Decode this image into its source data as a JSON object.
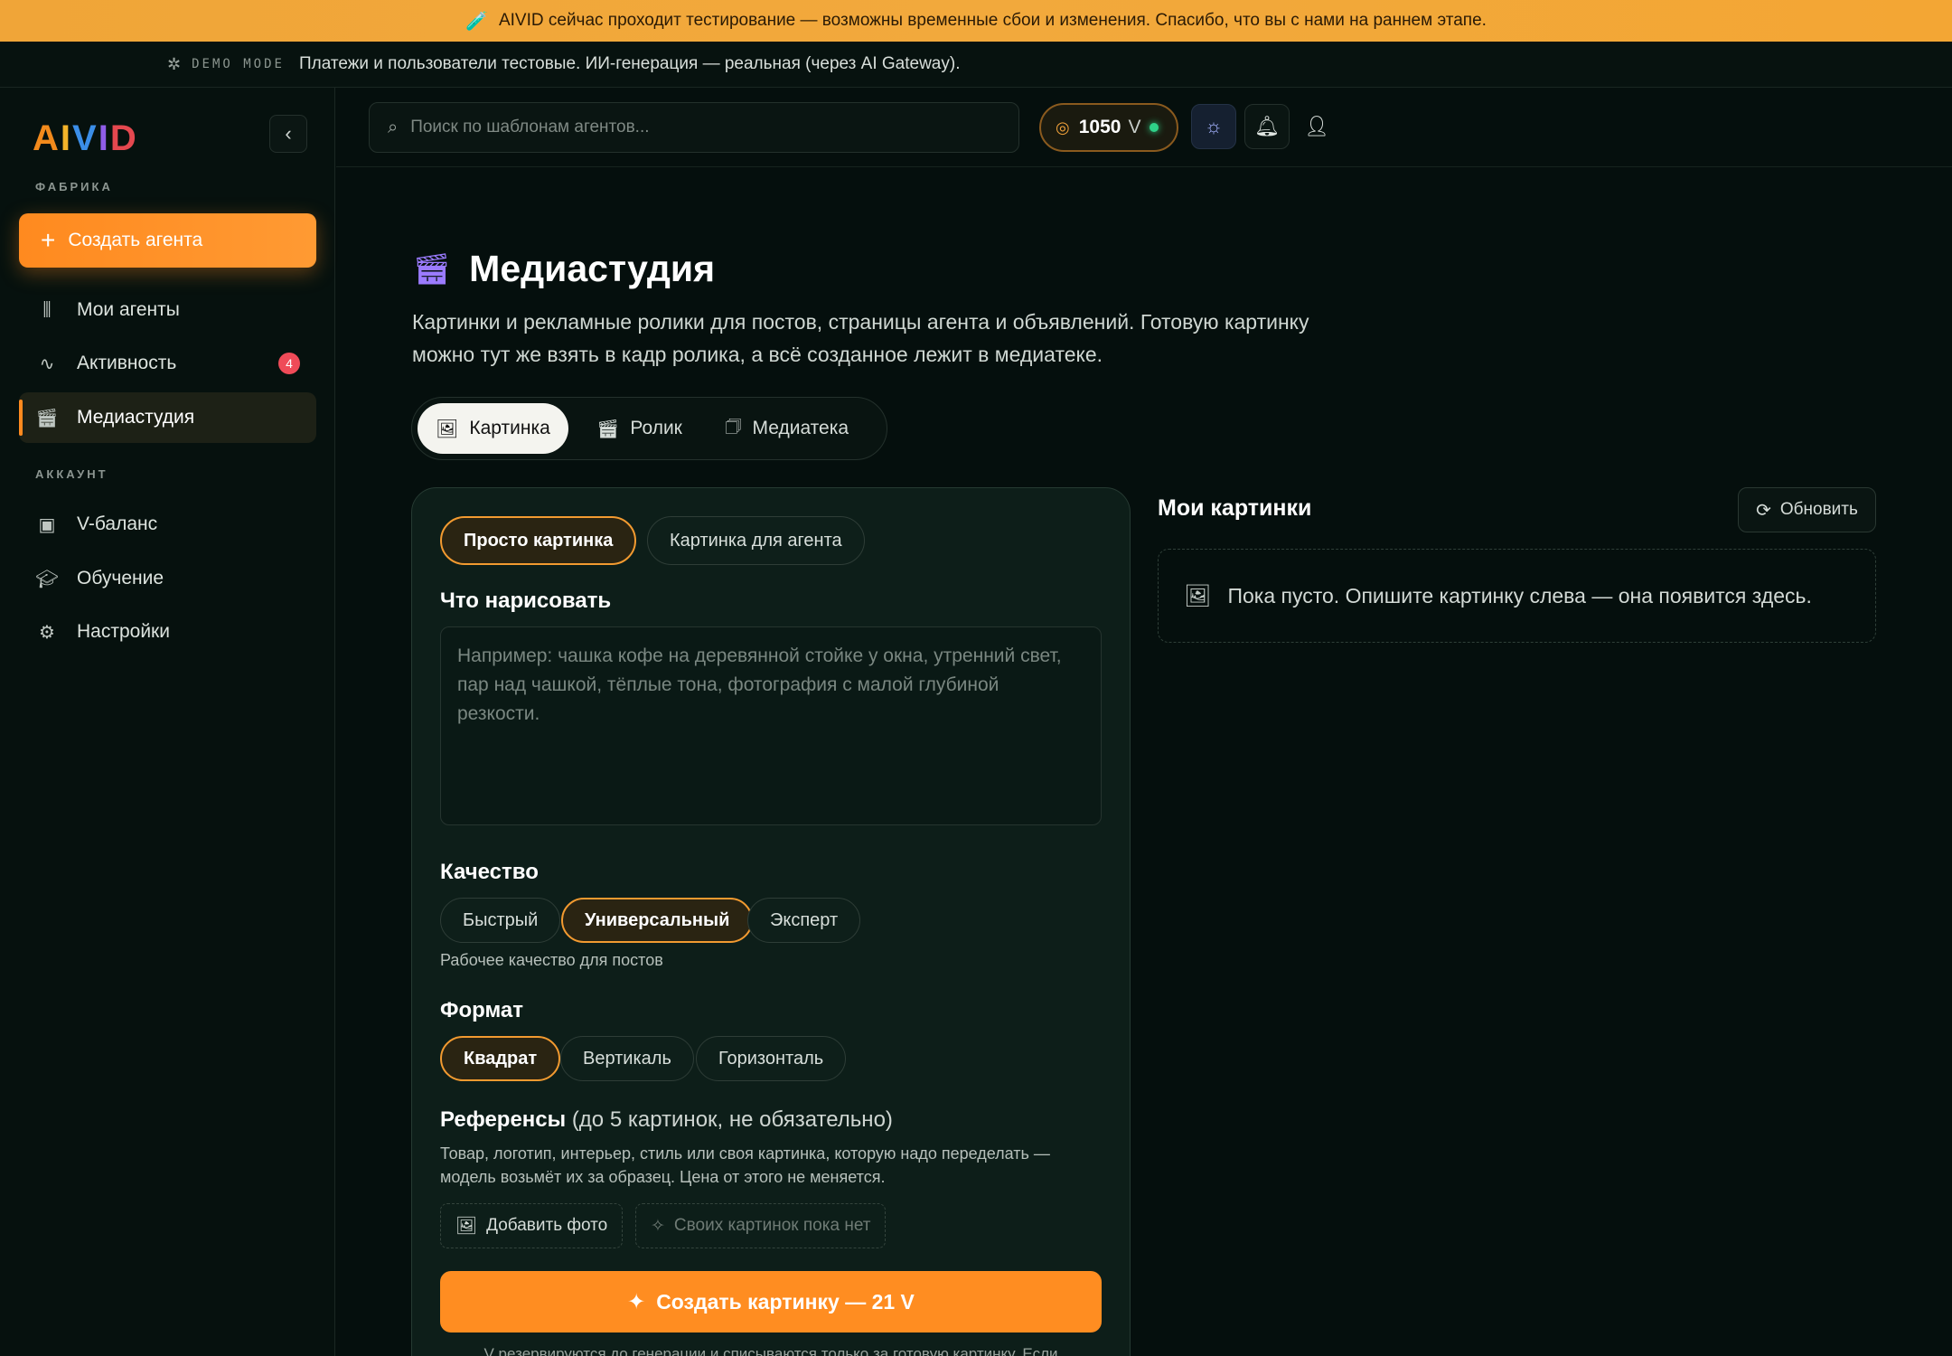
{
  "banner": {
    "icon": "flask-icon",
    "text": "AIVID сейчас проходит тестирование — возможны временные сбои и изменения. Спасибо, что вы с нами на раннем этапе."
  },
  "demo": {
    "mode_label": "DEMO MODE",
    "text": "Платежи и пользователи тестовые. ИИ-генерация — реальная (через AI Gateway)."
  },
  "sidebar": {
    "logo_letters": [
      "A",
      "I",
      "V",
      "I",
      "D"
    ],
    "section_factory": "ФАБРИКА",
    "create_label": "Создать агента",
    "items": [
      {
        "label": "Мои агенты"
      },
      {
        "label": "Активность",
        "badge": "4"
      },
      {
        "label": "Медиастудия"
      }
    ],
    "section_account": "АККАУНТ",
    "account_items": [
      {
        "label": "V-баланс"
      },
      {
        "label": "Обучение"
      },
      {
        "label": "Настройки"
      }
    ]
  },
  "header": {
    "search_placeholder": "Поиск по шаблонам агентов...",
    "balance_value": "1050",
    "balance_unit": "V"
  },
  "page": {
    "title": "Медиастудия",
    "description": "Картинки и рекламные ролики для постов, страницы агента и объявлений. Готовую картинку можно тут же взять в кадр ролика, а всё созданное лежит в медиатеке.",
    "tabs": [
      {
        "label": "Картинка"
      },
      {
        "label": "Ролик"
      },
      {
        "label": "Медиатека"
      }
    ]
  },
  "form": {
    "mode_pills": [
      {
        "label": "Просто картинка"
      },
      {
        "label": "Картинка для агента"
      }
    ],
    "prompt_label": "Что нарисовать",
    "prompt_placeholder": "Например: чашка кофе на деревянной стойке у окна, утренний свет, пар над чашкой, тёплые тона, фотография с малой глубиной резкости.",
    "quality_label": "Качество",
    "quality_options": [
      {
        "label": "Быстрый"
      },
      {
        "label": "Универсальный"
      },
      {
        "label": "Эксперт"
      }
    ],
    "quality_hint": "Рабочее качество для постов",
    "format_label": "Формат",
    "format_options": [
      {
        "label": "Квадрат"
      },
      {
        "label": "Вертикаль"
      },
      {
        "label": "Горизонталь"
      }
    ],
    "refs_label": "Референсы",
    "refs_sub": "(до 5 картинок, не обязательно)",
    "refs_hint": "Товар, логотип, интерьер, стиль или своя картинка, которую надо переделать — модель возьмёт их за образец. Цена от этого не меняется.",
    "add_photo_label": "Добавить фото",
    "no_own_images_label": "Своих картинок пока нет",
    "generate_label": "Создать картинку — 21 V",
    "note": "V резервируются до генерации и списываются только за готовую картинку. Если"
  },
  "gallery": {
    "title": "Мои картинки",
    "refresh_label": "Обновить",
    "empty_text": "Пока пусто. Опишите картинку слева — она появится здесь."
  },
  "colors": {
    "accent": "#ff8a1f",
    "banner": "#f2a93c",
    "background": "#050f0d",
    "card": "#0d1e19",
    "badge": "#ef4b58",
    "status_online": "#2fd189"
  }
}
